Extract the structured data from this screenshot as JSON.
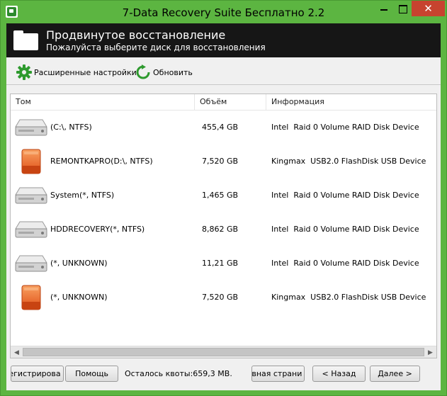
{
  "window": {
    "title": "7-Data Recovery Suite Бесплатно 2.2",
    "close_glyph": "✕",
    "accent_color": "#5cb541"
  },
  "header": {
    "title": "Продвинутое восстановление",
    "subtitle": "Пожалуйста выберите диск для восстановления",
    "icon": "folder-icon"
  },
  "toolbar": {
    "settings_label": "Расширенные настройки",
    "refresh_label": "Обновить"
  },
  "table": {
    "columns": [
      "Том",
      "Объём",
      "Информация"
    ],
    "rows": [
      {
        "name": "(C:\\, NTFS)",
        "size": "455,4 GB",
        "info": "Intel  Raid 0 Volume RAID Disk Device",
        "icon": "hard-drive-icon"
      },
      {
        "name": "REMONTKAPRO(D:\\, NTFS)",
        "size": "7,520 GB",
        "info": "Kingmax  USB2.0 FlashDisk USB Device",
        "icon": "usb-drive-icon"
      },
      {
        "name": "System(*, NTFS)",
        "size": "1,465 GB",
        "info": "Intel  Raid 0 Volume RAID Disk Device",
        "icon": "hard-drive-icon"
      },
      {
        "name": "HDDRECOVERY(*, NTFS)",
        "size": "8,862 GB",
        "info": "Intel  Raid 0 Volume RAID Disk Device",
        "icon": "hard-drive-icon"
      },
      {
        "name": "(*, UNKNOWN)",
        "size": "11,21 GB",
        "info": "Intel  Raid 0 Volume RAID Disk Device",
        "icon": "hard-drive-icon"
      },
      {
        "name": "(*, UNKNOWN)",
        "size": "7,520 GB",
        "info": "Kingmax  USB2.0 FlashDisk USB Device",
        "icon": "usb-drive-icon"
      }
    ]
  },
  "footer": {
    "register_label": "регистрирова",
    "help_label": "Помощь",
    "quota_text": "Осталось квоты:659,3 MB.",
    "home_label": "авная страни",
    "back_label": "< Назад",
    "next_label": "Далее >"
  }
}
